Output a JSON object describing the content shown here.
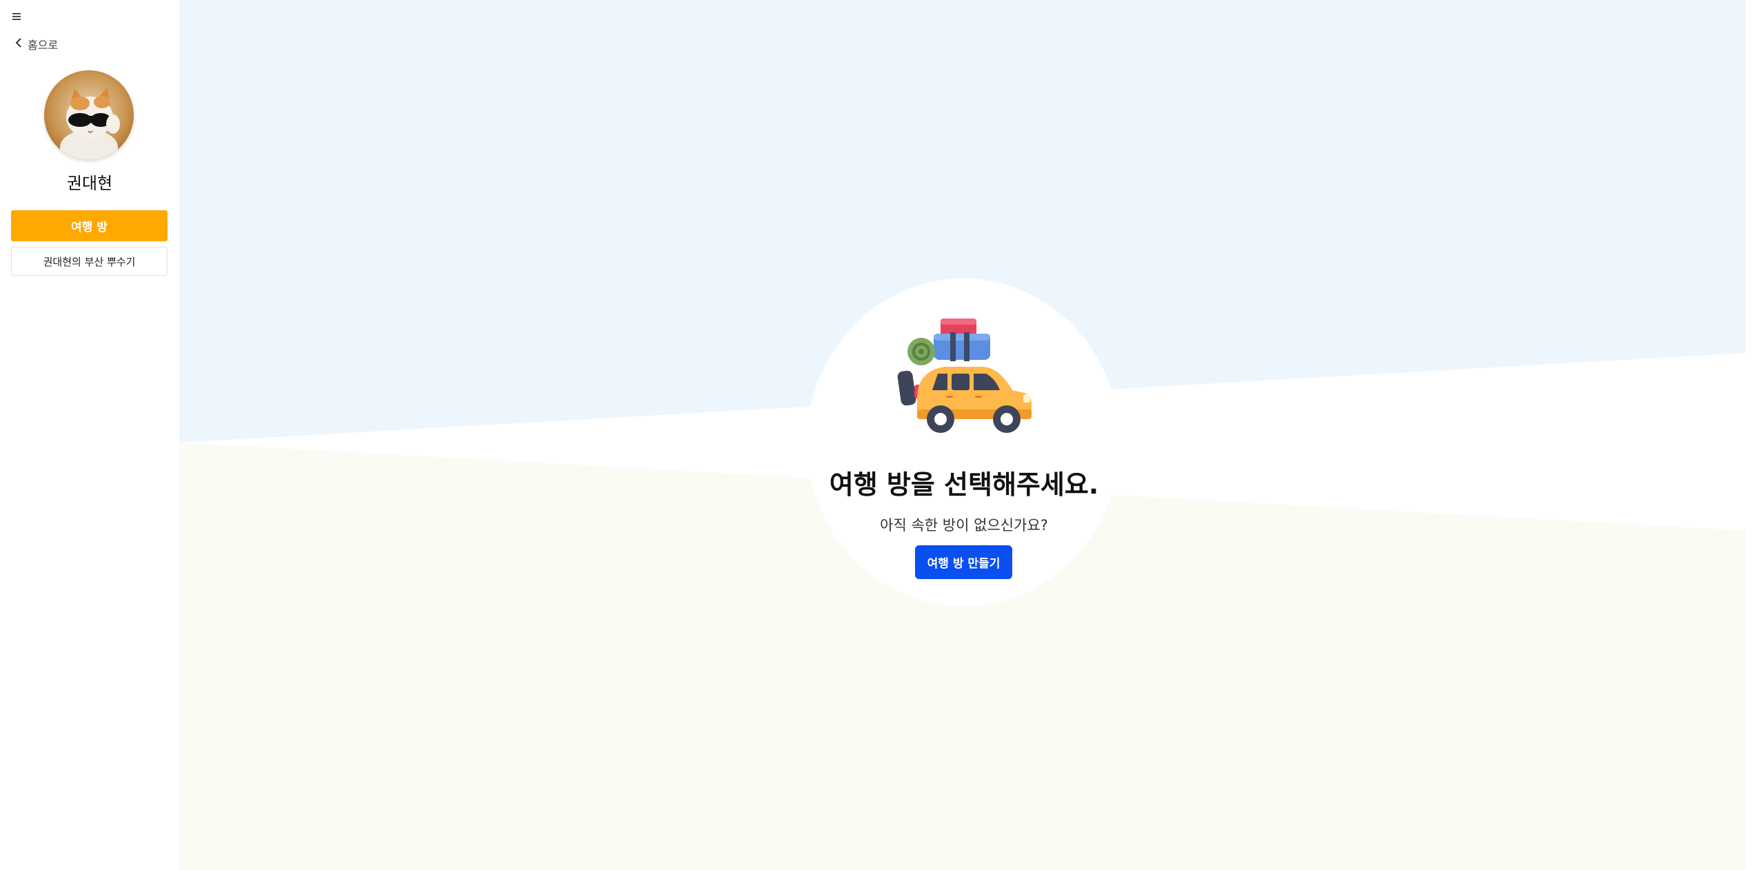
{
  "sidebar": {
    "back_label": "홈으로",
    "user_name": "권대현",
    "items": [
      {
        "label": "여행 방"
      },
      {
        "label": "권대현의 부산 뿌수기"
      }
    ]
  },
  "main": {
    "headline": "여행 방을 선택해주세요.",
    "subline": "아직 속한 방이 없으신가요?",
    "create_button": "여행 방 만들기"
  },
  "colors": {
    "accent_orange": "#ffa800",
    "primary_blue": "#0a4ff0",
    "bg_top": "#eef6fd",
    "bg_bottom": "#f8fcf2"
  }
}
